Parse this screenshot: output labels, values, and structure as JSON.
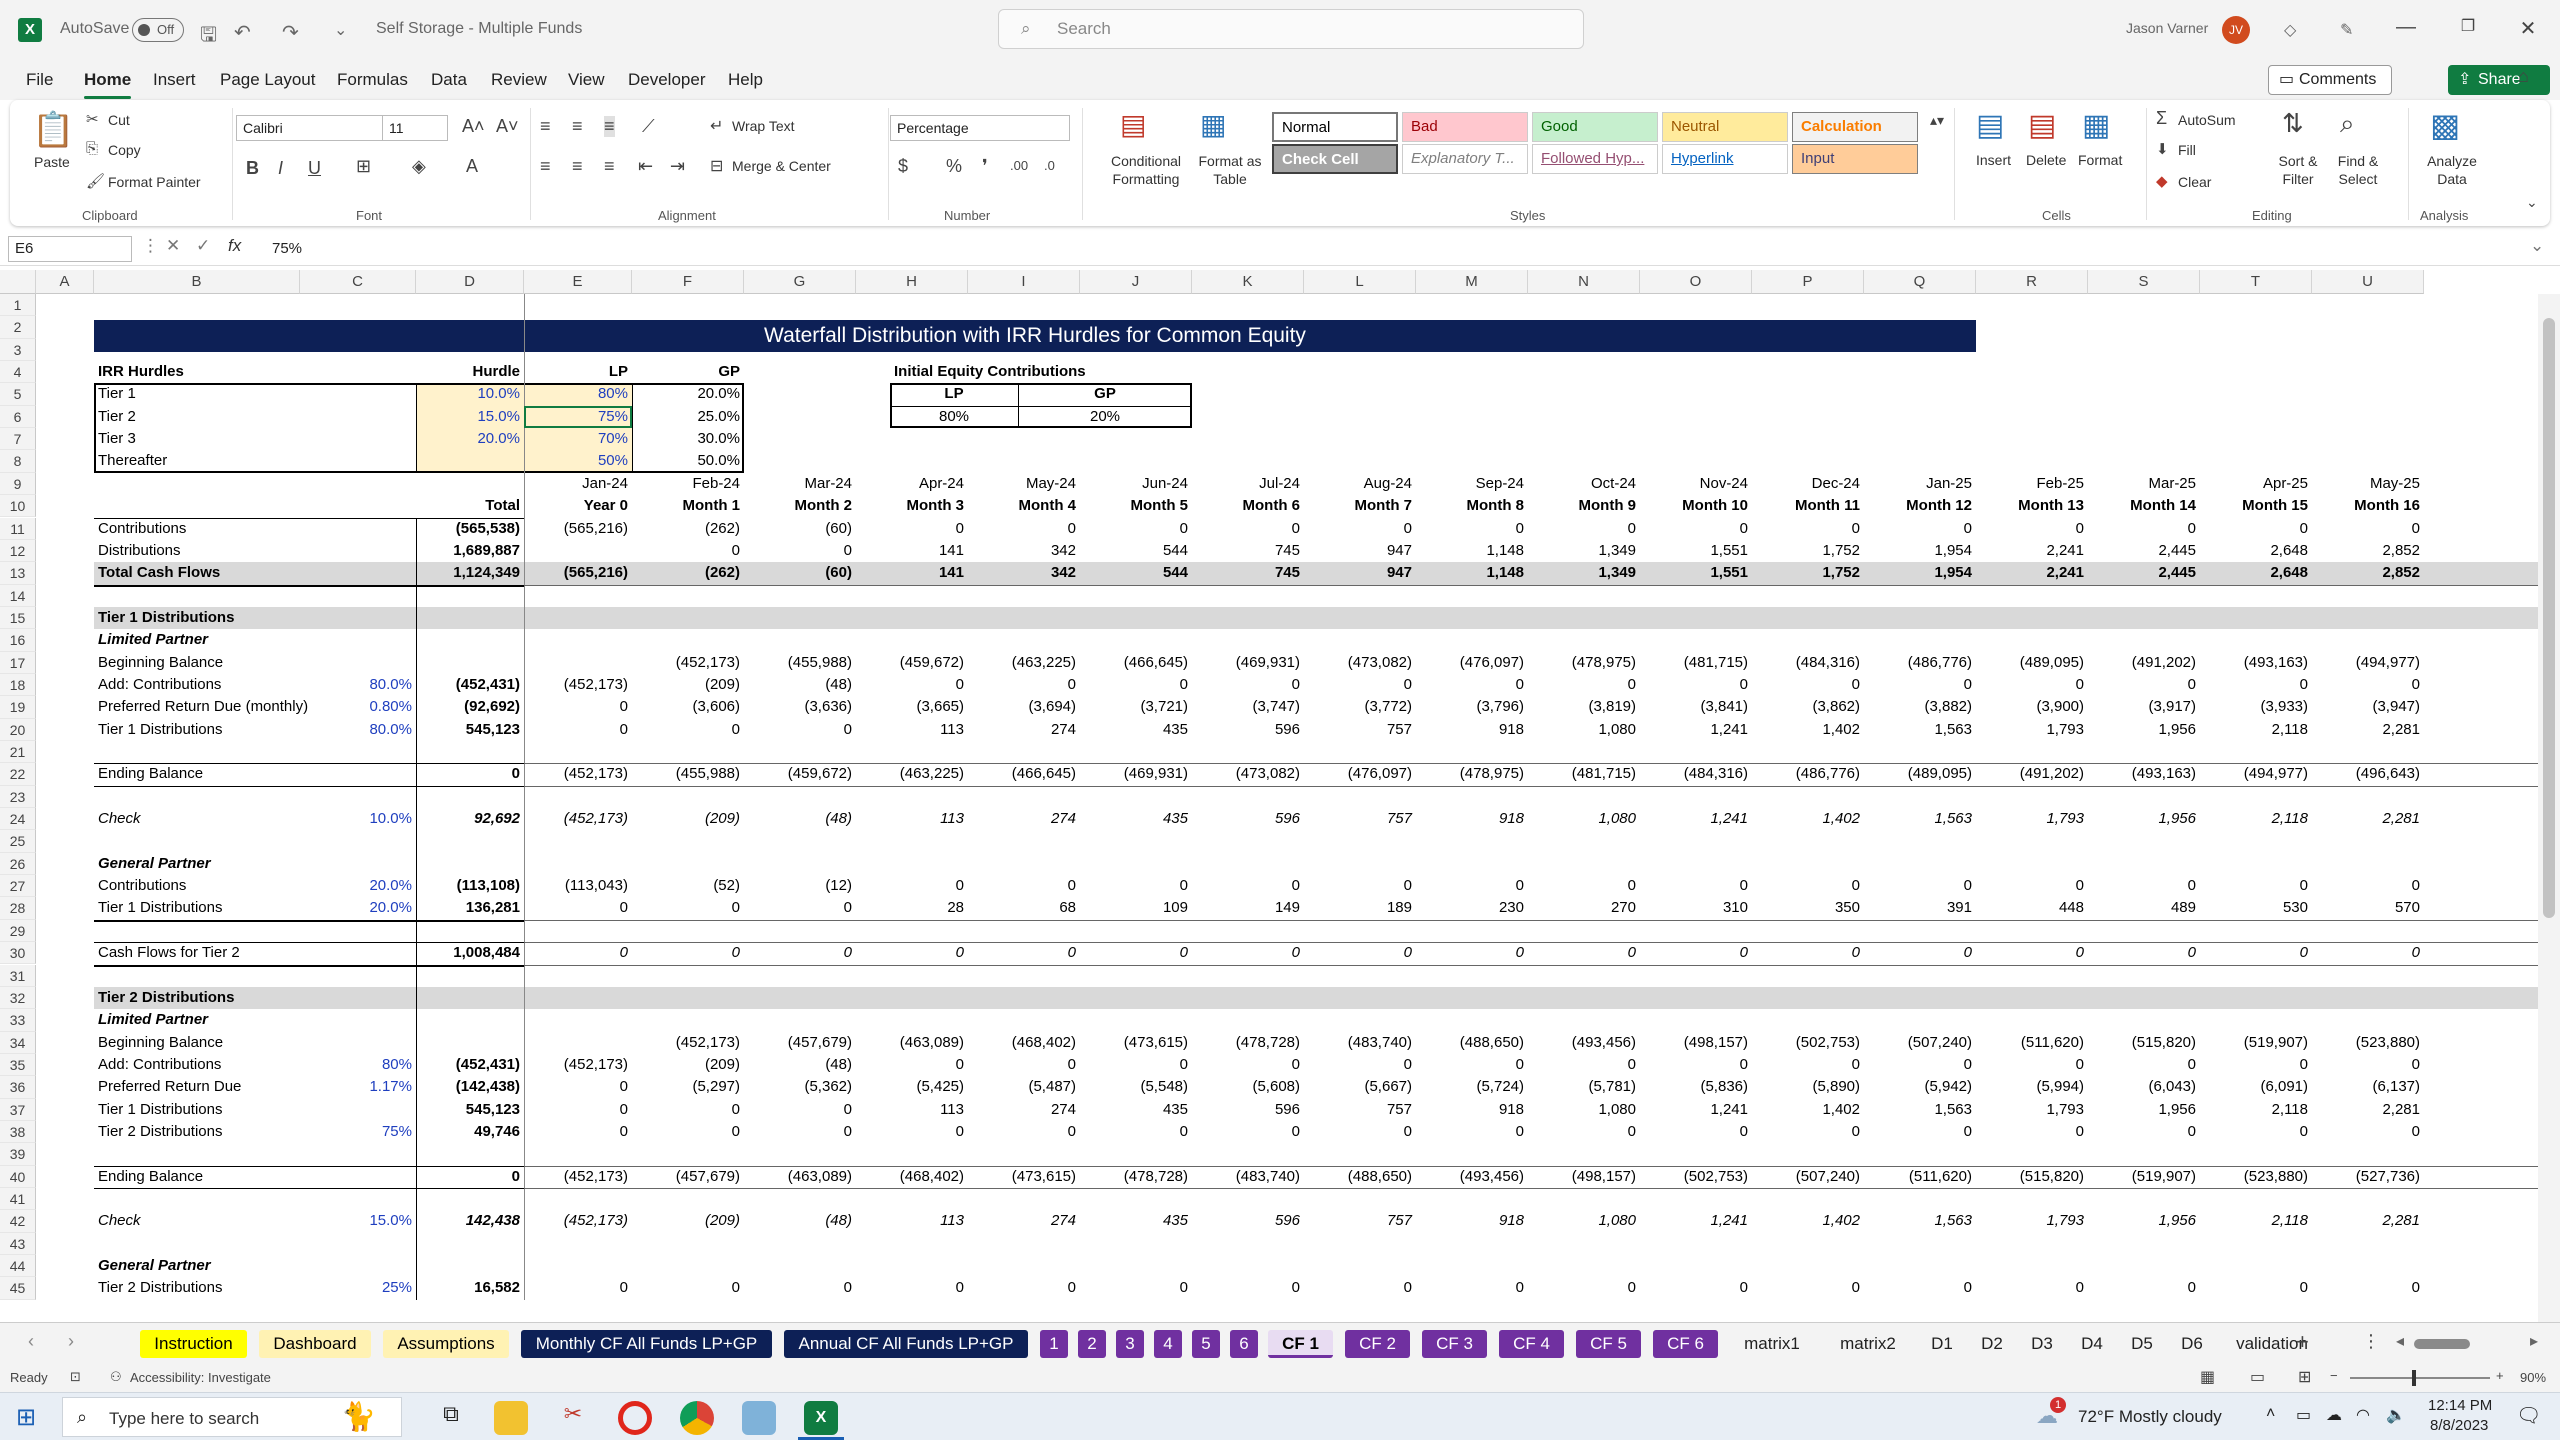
{
  "app": {
    "autosave": "AutoSave",
    "autosave_state": "Off",
    "doc_title": "Self Storage - Multiple Funds",
    "search_placeholder": "Search",
    "user": "Jason Varner",
    "user_initials": "JV"
  },
  "menu": [
    "File",
    "Home",
    "Insert",
    "Page Layout",
    "Formulas",
    "Data",
    "Review",
    "View",
    "Developer",
    "Help"
  ],
  "menu_active": "Home",
  "topbuttons": {
    "comments": "Comments",
    "share": "Share"
  },
  "ribbon": {
    "clipboard": {
      "paste": "Paste",
      "cut": "Cut",
      "copy": "Copy",
      "format_painter": "Format Painter",
      "group": "Clipboard"
    },
    "font": {
      "name": "Calibri",
      "size": "11",
      "group": "Font"
    },
    "alignment": {
      "wrap": "Wrap Text",
      "merge": "Merge & Center",
      "group": "Alignment"
    },
    "number": {
      "format": "Percentage",
      "group": "Number"
    },
    "styles": {
      "cond": "Conditional Formatting",
      "table": "Format as Table",
      "group": "Styles",
      "cells": [
        {
          "label": "Normal",
          "bg": "#ffffff",
          "fg": "#000000"
        },
        {
          "label": "Bad",
          "bg": "#ffc7ce",
          "fg": "#9c0006"
        },
        {
          "label": "Good",
          "bg": "#c6efce",
          "fg": "#006100"
        },
        {
          "label": "Neutral",
          "bg": "#ffeb9c",
          "fg": "#9c5700"
        },
        {
          "label": "Calculation",
          "bg": "#f2f2f2",
          "fg": "#fa7d00"
        },
        {
          "label": "Check Cell",
          "bg": "#a5a5a5",
          "fg": "#ffffff"
        },
        {
          "label": "Explanatory T...",
          "bg": "#ffffff",
          "fg": "#7f7f7f"
        },
        {
          "label": "Followed Hyp...",
          "bg": "#ffffff",
          "fg": "#954f72"
        },
        {
          "label": "Hyperlink",
          "bg": "#ffffff",
          "fg": "#0563c1"
        },
        {
          "label": "Input",
          "bg": "#ffcc99",
          "fg": "#3f3f76"
        }
      ]
    },
    "cells": {
      "insert": "Insert",
      "delete": "Delete",
      "format": "Format",
      "group": "Cells"
    },
    "editing": {
      "autosum": "AutoSum",
      "fill": "Fill",
      "clear": "Clear",
      "sort": "Sort & Filter",
      "find": "Find & Select",
      "group": "Editing"
    },
    "analysis": {
      "analyze": "Analyze Data",
      "group": "Analysis"
    }
  },
  "formula_bar": {
    "name_box": "E6",
    "content": "75%"
  },
  "columns": [
    "A",
    "B",
    "C",
    "D",
    "E",
    "F",
    "G",
    "H",
    "I",
    "J",
    "K",
    "L",
    "M",
    "N",
    "O",
    "P",
    "Q",
    "R",
    "S",
    "T",
    "U"
  ],
  "rows": [
    "1",
    "2",
    "3",
    "4",
    "5",
    "6",
    "7",
    "8",
    "9",
    "10",
    "11",
    "12",
    "13",
    "14",
    "15",
    "16",
    "17",
    "18",
    "19",
    "20",
    "21",
    "22",
    "23",
    "24",
    "25",
    "26",
    "27",
    "28",
    "29",
    "30",
    "31",
    "32",
    "33",
    "34",
    "35",
    "36",
    "37",
    "38",
    "39",
    "40",
    "41",
    "42",
    "43",
    "44",
    "45"
  ],
  "sheet": {
    "title": "Waterfall Distribution with IRR Hurdles for Common Equity",
    "hurdles": {
      "header": "IRR Hurdles",
      "col_hurdle": "Hurdle",
      "col_lp": "LP",
      "col_gp": "GP",
      "rows": [
        {
          "label": "Tier 1",
          "hurdle": "10.0%",
          "lp": "80%",
          "gp": "20.0%"
        },
        {
          "label": "Tier 2",
          "hurdle": "15.0%",
          "lp": "75%",
          "gp": "25.0%"
        },
        {
          "label": "Tier 3",
          "hurdle": "20.0%",
          "lp": "70%",
          "gp": "30.0%"
        },
        {
          "label": "Thereafter",
          "hurdle": "",
          "lp": "50%",
          "gp": "50.0%"
        }
      ]
    },
    "initial_equity": {
      "header": "Initial Equity Contributions",
      "lp_label": "LP",
      "gp_label": "GP",
      "lp": "80%",
      "gp": "20%"
    },
    "months": [
      "Jan-24",
      "Feb-24",
      "Mar-24",
      "Apr-24",
      "May-24",
      "Jun-24",
      "Jul-24",
      "Aug-24",
      "Sep-24",
      "Oct-24",
      "Nov-24",
      "Dec-24",
      "Jan-25",
      "Feb-25",
      "Mar-25",
      "Apr-25",
      "May-25"
    ],
    "periods": [
      "Year 0",
      "Month 1",
      "Month 2",
      "Month 3",
      "Month 4",
      "Month 5",
      "Month 6",
      "Month 7",
      "Month 8",
      "Month 9",
      "Month 10",
      "Month 11",
      "Month 12",
      "Month 13",
      "Month 14",
      "Month 15",
      "Month 16"
    ],
    "total_label": "Total",
    "data_rows": [
      {
        "row": 11,
        "label": "Contributions",
        "pct": "",
        "total": "(565,538)",
        "vals": [
          "(565,216)",
          "(262)",
          "(60)",
          "0",
          "0",
          "0",
          "0",
          "0",
          "0",
          "0",
          "0",
          "0",
          "0",
          "0",
          "0",
          "0",
          "0"
        ]
      },
      {
        "row": 12,
        "label": "Distributions",
        "pct": "",
        "total": "1,689,887",
        "vals": [
          "",
          "0",
          "0",
          "141",
          "342",
          "544",
          "745",
          "947",
          "1,148",
          "1,349",
          "1,551",
          "1,752",
          "1,954",
          "2,241",
          "2,445",
          "2,648",
          "2,852"
        ]
      },
      {
        "row": 13,
        "label": "Total Cash Flows",
        "pct": "",
        "total": "1,124,349",
        "vals": [
          "(565,216)",
          "(262)",
          "(60)",
          "141",
          "342",
          "544",
          "745",
          "947",
          "1,148",
          "1,349",
          "1,551",
          "1,752",
          "1,954",
          "2,241",
          "2,445",
          "2,648",
          "2,852"
        ],
        "style": "b"
      },
      {
        "row": 15,
        "label": "Tier 1 Distributions",
        "pct": "",
        "total": "",
        "vals": [],
        "style": "b"
      },
      {
        "row": 16,
        "label": "Limited Partner",
        "pct": "",
        "total": "",
        "vals": [],
        "style": "bi"
      },
      {
        "row": 17,
        "label": "Beginning Balance",
        "pct": "",
        "total": "",
        "vals": [
          "",
          "(452,173)",
          "(455,988)",
          "(459,672)",
          "(463,225)",
          "(466,645)",
          "(469,931)",
          "(473,082)",
          "(476,097)",
          "(478,975)",
          "(481,715)",
          "(484,316)",
          "(486,776)",
          "(489,095)",
          "(491,202)",
          "(493,163)",
          "(494,977)"
        ]
      },
      {
        "row": 18,
        "label": "Add: Contributions",
        "pct": "80.0%",
        "total": "(452,431)",
        "vals": [
          "(452,173)",
          "(209)",
          "(48)",
          "0",
          "0",
          "0",
          "0",
          "0",
          "0",
          "0",
          "0",
          "0",
          "0",
          "0",
          "0",
          "0",
          "0"
        ]
      },
      {
        "row": 19,
        "label": "Preferred Return Due (monthly)",
        "pct": "0.80%",
        "total": "(92,692)",
        "vals": [
          "0",
          "(3,606)",
          "(3,636)",
          "(3,665)",
          "(3,694)",
          "(3,721)",
          "(3,747)",
          "(3,772)",
          "(3,796)",
          "(3,819)",
          "(3,841)",
          "(3,862)",
          "(3,882)",
          "(3,900)",
          "(3,917)",
          "(3,933)",
          "(3,947)"
        ]
      },
      {
        "row": 20,
        "label": "Tier 1 Distributions",
        "pct": "80.0%",
        "total": "545,123",
        "vals": [
          "0",
          "0",
          "0",
          "113",
          "274",
          "435",
          "596",
          "757",
          "918",
          "1,080",
          "1,241",
          "1,402",
          "1,563",
          "1,793",
          "1,956",
          "2,118",
          "2,281"
        ]
      },
      {
        "row": 22,
        "label": "Ending Balance",
        "pct": "",
        "total": "0",
        "vals": [
          "(452,173)",
          "(455,988)",
          "(459,672)",
          "(463,225)",
          "(466,645)",
          "(469,931)",
          "(473,082)",
          "(476,097)",
          "(478,975)",
          "(481,715)",
          "(484,316)",
          "(486,776)",
          "(489,095)",
          "(491,202)",
          "(493,163)",
          "(494,977)",
          "(496,643)"
        ]
      },
      {
        "row": 24,
        "label": "Check",
        "pct": "10.0%",
        "total": "92,692",
        "vals": [
          "(452,173)",
          "(209)",
          "(48)",
          "113",
          "274",
          "435",
          "596",
          "757",
          "918",
          "1,080",
          "1,241",
          "1,402",
          "1,563",
          "1,793",
          "1,956",
          "2,118",
          "2,281"
        ],
        "style": "i"
      },
      {
        "row": 26,
        "label": "General Partner",
        "pct": "",
        "total": "",
        "vals": [],
        "style": "bi"
      },
      {
        "row": 27,
        "label": "Contributions",
        "pct": "20.0%",
        "total": "(113,108)",
        "vals": [
          "(113,043)",
          "(52)",
          "(12)",
          "0",
          "0",
          "0",
          "0",
          "0",
          "0",
          "0",
          "0",
          "0",
          "0",
          "0",
          "0",
          "0",
          "0"
        ]
      },
      {
        "row": 28,
        "label": "Tier 1 Distributions",
        "pct": "20.0%",
        "total": "136,281",
        "vals": [
          "0",
          "0",
          "0",
          "28",
          "68",
          "109",
          "149",
          "189",
          "230",
          "270",
          "310",
          "350",
          "391",
          "448",
          "489",
          "530",
          "570"
        ]
      },
      {
        "row": 30,
        "label": "Cash Flows for Tier 2",
        "pct": "",
        "total": "1,008,484",
        "vals": [
          "0",
          "0",
          "0",
          "0",
          "0",
          "0",
          "0",
          "0",
          "0",
          "0",
          "0",
          "0",
          "0",
          "0",
          "0",
          "0",
          "0"
        ],
        "valstyle": "i"
      },
      {
        "row": 32,
        "label": "Tier 2 Distributions",
        "pct": "",
        "total": "",
        "vals": [],
        "style": "b"
      },
      {
        "row": 33,
        "label": "Limited Partner",
        "pct": "",
        "total": "",
        "vals": [],
        "style": "bi"
      },
      {
        "row": 34,
        "label": "Beginning Balance",
        "pct": "",
        "total": "",
        "vals": [
          "",
          "(452,173)",
          "(457,679)",
          "(463,089)",
          "(468,402)",
          "(473,615)",
          "(478,728)",
          "(483,740)",
          "(488,650)",
          "(493,456)",
          "(498,157)",
          "(502,753)",
          "(507,240)",
          "(511,620)",
          "(515,820)",
          "(519,907)",
          "(523,880)"
        ]
      },
      {
        "row": 35,
        "label": "Add: Contributions",
        "pct": "80%",
        "total": "(452,431)",
        "vals": [
          "(452,173)",
          "(209)",
          "(48)",
          "0",
          "0",
          "0",
          "0",
          "0",
          "0",
          "0",
          "0",
          "0",
          "0",
          "0",
          "0",
          "0",
          "0"
        ]
      },
      {
        "row": 36,
        "label": "Preferred Return Due",
        "pct": "1.17%",
        "total": "(142,438)",
        "vals": [
          "0",
          "(5,297)",
          "(5,362)",
          "(5,425)",
          "(5,487)",
          "(5,548)",
          "(5,608)",
          "(5,667)",
          "(5,724)",
          "(5,781)",
          "(5,836)",
          "(5,890)",
          "(5,942)",
          "(5,994)",
          "(6,043)",
          "(6,091)",
          "(6,137)"
        ]
      },
      {
        "row": 37,
        "label": "Tier 1 Distributions",
        "pct": "",
        "total": "545,123",
        "vals": [
          "0",
          "0",
          "0",
          "113",
          "274",
          "435",
          "596",
          "757",
          "918",
          "1,080",
          "1,241",
          "1,402",
          "1,563",
          "1,793",
          "1,956",
          "2,118",
          "2,281"
        ]
      },
      {
        "row": 38,
        "label": "Tier 2 Distributions",
        "pct": "75%",
        "total": "49,746",
        "vals": [
          "0",
          "0",
          "0",
          "0",
          "0",
          "0",
          "0",
          "0",
          "0",
          "0",
          "0",
          "0",
          "0",
          "0",
          "0",
          "0",
          "0"
        ]
      },
      {
        "row": 40,
        "label": "Ending Balance",
        "pct": "",
        "total": "0",
        "vals": [
          "(452,173)",
          "(457,679)",
          "(463,089)",
          "(468,402)",
          "(473,615)",
          "(478,728)",
          "(483,740)",
          "(488,650)",
          "(493,456)",
          "(498,157)",
          "(502,753)",
          "(507,240)",
          "(511,620)",
          "(515,820)",
          "(519,907)",
          "(523,880)",
          "(527,736)"
        ]
      },
      {
        "row": 42,
        "label": "Check",
        "pct": "15.0%",
        "total": "142,438",
        "vals": [
          "(452,173)",
          "(209)",
          "(48)",
          "113",
          "274",
          "435",
          "596",
          "757",
          "918",
          "1,080",
          "1,241",
          "1,402",
          "1,563",
          "1,793",
          "1,956",
          "2,118",
          "2,281"
        ],
        "style": "i"
      },
      {
        "row": 44,
        "label": "General Partner",
        "pct": "",
        "total": "",
        "vals": [],
        "style": "bi"
      },
      {
        "row": 45,
        "label": "Tier 2 Distributions",
        "pct": "25%",
        "total": "16,582",
        "vals": [
          "0",
          "0",
          "0",
          "0",
          "0",
          "0",
          "0",
          "0",
          "0",
          "0",
          "0",
          "0",
          "0",
          "0",
          "0",
          "0",
          "0"
        ]
      }
    ]
  },
  "tabs": [
    {
      "label": "Instruction",
      "bg": "#ffff00",
      "fg": "#000000"
    },
    {
      "label": "Dashboard",
      "bg": "#fff2b3",
      "fg": "#000000"
    },
    {
      "label": "Assumptions",
      "bg": "#fff2b3",
      "fg": "#000000"
    },
    {
      "label": "Monthly CF All Funds LP+GP",
      "bg": "#0d2056",
      "fg": "#ffffff"
    },
    {
      "label": "Annual CF All Funds LP+GP",
      "bg": "#0d2056",
      "fg": "#ffffff"
    },
    {
      "label": "1",
      "bg": "#7030a0",
      "fg": "#ffffff"
    },
    {
      "label": "2",
      "bg": "#7030a0",
      "fg": "#ffffff"
    },
    {
      "label": "3",
      "bg": "#7030a0",
      "fg": "#ffffff"
    },
    {
      "label": "4",
      "bg": "#7030a0",
      "fg": "#ffffff"
    },
    {
      "label": "5",
      "bg": "#7030a0",
      "fg": "#ffffff"
    },
    {
      "label": "6",
      "bg": "#7030a0",
      "fg": "#ffffff"
    },
    {
      "label": "CF 1",
      "bg": "#e8dcf2",
      "fg": "#000000"
    },
    {
      "label": "CF 2",
      "bg": "#7030a0",
      "fg": "#ffffff"
    },
    {
      "label": "CF 3",
      "bg": "#7030a0",
      "fg": "#ffffff"
    },
    {
      "label": "CF 4",
      "bg": "#7030a0",
      "fg": "#ffffff"
    },
    {
      "label": "CF 5",
      "bg": "#7030a0",
      "fg": "#ffffff"
    },
    {
      "label": "CF 6",
      "bg": "#7030a0",
      "fg": "#ffffff"
    },
    {
      "label": "matrix1",
      "bg": "#f3f3f3",
      "fg": "#222222"
    },
    {
      "label": "matrix2",
      "bg": "#f3f3f3",
      "fg": "#222222"
    },
    {
      "label": "D1",
      "bg": "#f3f3f3",
      "fg": "#222222"
    },
    {
      "label": "D2",
      "bg": "#f3f3f3",
      "fg": "#222222"
    },
    {
      "label": "D3",
      "bg": "#f3f3f3",
      "fg": "#222222"
    },
    {
      "label": "D4",
      "bg": "#f3f3f3",
      "fg": "#222222"
    },
    {
      "label": "D5",
      "bg": "#f3f3f3",
      "fg": "#222222"
    },
    {
      "label": "D6",
      "bg": "#f3f3f3",
      "fg": "#222222"
    },
    {
      "label": "validation",
      "bg": "#f3f3f3",
      "fg": "#222222"
    }
  ],
  "status": {
    "ready": "Ready",
    "accessibility": "Accessibility: Investigate",
    "zoom": "90%"
  },
  "taskbar": {
    "search": "Type here to search",
    "weather": "72°F  Mostly cloudy",
    "time": "12:14 PM",
    "date": "8/8/2023",
    "notif": "1"
  }
}
